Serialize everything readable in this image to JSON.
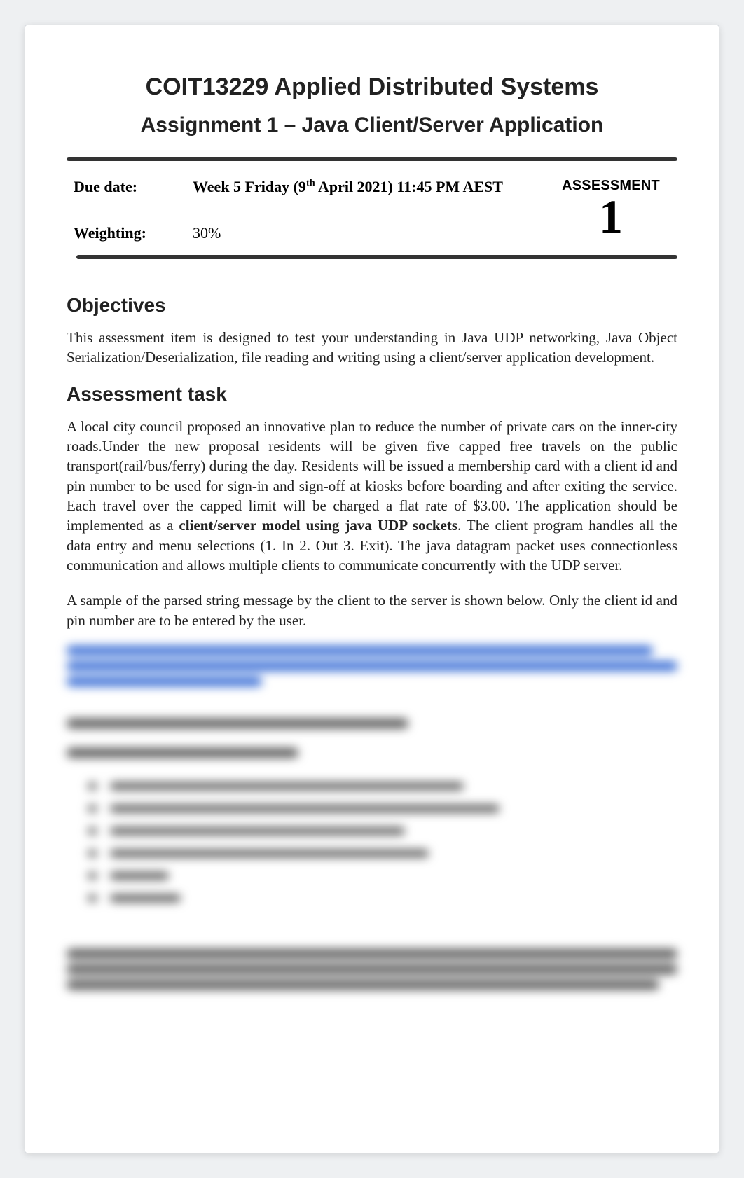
{
  "header": {
    "course_title": "COIT13229 Applied Distributed Systems",
    "assignment_title": "Assignment 1 – Java Client/Server Application"
  },
  "meta": {
    "due_date_label": "Due date:",
    "due_date_value_prefix": "Week 5 Friday (9",
    "due_date_ordinal": "th",
    "due_date_value_suffix": " April 2021) 11:45 PM AEST",
    "weighting_label": "Weighting:",
    "weighting_value": "30%",
    "assessment_label": "ASSESSMENT",
    "assessment_number": "1"
  },
  "sections": {
    "objectives_heading": "Objectives",
    "objectives_text": "This assessment item is designed to test your understanding in Java UDP networking, Java Object Serialization/Deserialization, file reading and writing using a client/server application development.",
    "task_heading": "Assessment task",
    "task_p1_a": "A local city council proposed an innovative plan to reduce the number of private cars on the inner-city roads.Under the new proposal residents will be given five capped free travels on the public transport(rail/bus/ferry) during the day. Residents will be issued a membership card with a client id and pin number to be used for sign-in and sign-off at kiosks before boarding and after exiting the service. Each travel over the capped limit will be charged a flat rate of $3.00. The application should be implemented as a ",
    "task_p1_bold": "client/server model using java UDP sockets",
    "task_p1_b": ". The client program handles all the data entry and menu selections (1. In 2. Out 3. Exit). The java datagram packet uses connectionless communication and allows multiple clients to communicate concurrently with the UDP server.",
    "task_p2": "A sample of the parsed string message by the client to the server is shown below. Only the client id and pin number are to be entered by the user."
  }
}
